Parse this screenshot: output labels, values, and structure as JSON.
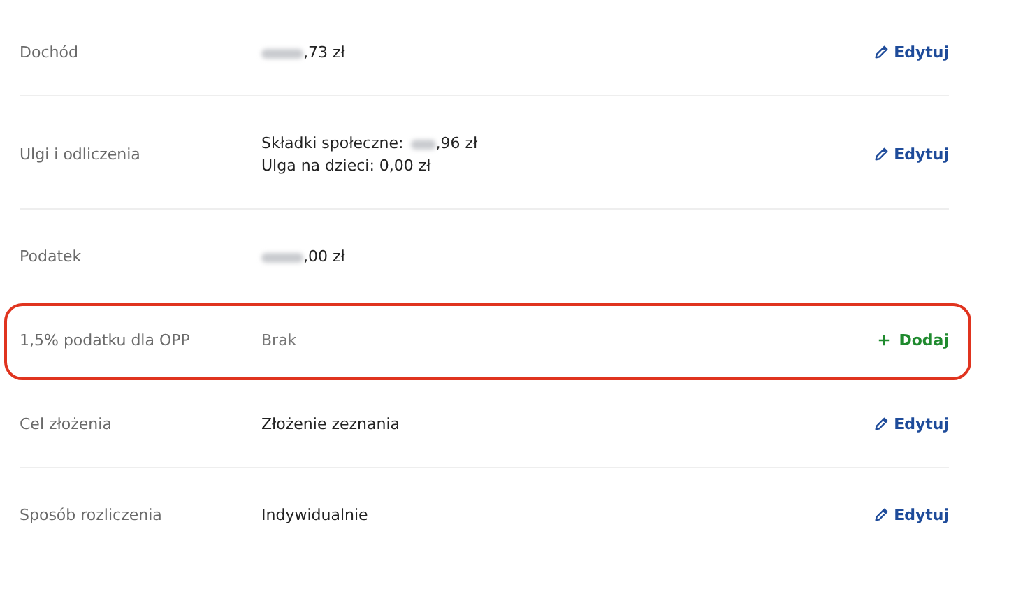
{
  "rows": [
    {
      "label": "Dochód",
      "highlighted": false,
      "muted": false,
      "lines": [
        {
          "redacted": true,
          "text": ",73 zł"
        }
      ],
      "action": {
        "kind": "edit",
        "label": "Edytuj"
      }
    },
    {
      "label": "Ulgi i odliczenia",
      "highlighted": false,
      "muted": false,
      "lines": [
        {
          "prefix": "Składki społeczne:",
          "redacted": true,
          "text": ",96 zł"
        },
        {
          "redacted": false,
          "text": "Ulga na dzieci: 0,00 zł"
        }
      ],
      "action": {
        "kind": "edit",
        "label": "Edytuj"
      }
    },
    {
      "label": "Podatek",
      "highlighted": false,
      "muted": false,
      "lines": [
        {
          "redacted": true,
          "text": ",00 zł"
        }
      ]
    },
    {
      "label": "1,5% podatku dla OPP",
      "highlighted": true,
      "muted": true,
      "lines": [
        {
          "redacted": false,
          "text": "Brak"
        }
      ],
      "action": {
        "kind": "add",
        "label": "Dodaj"
      }
    },
    {
      "label": "Cel złożenia",
      "highlighted": false,
      "muted": false,
      "lines": [
        {
          "redacted": false,
          "text": "Złożenie zeznania"
        }
      ],
      "action": {
        "kind": "edit",
        "label": "Edytuj"
      }
    },
    {
      "label": "Sposób rozliczenia",
      "highlighted": false,
      "muted": false,
      "lines": [
        {
          "redacted": false,
          "text": "Indywidualnie"
        }
      ],
      "action": {
        "kind": "edit",
        "label": "Edytuj"
      }
    }
  ]
}
